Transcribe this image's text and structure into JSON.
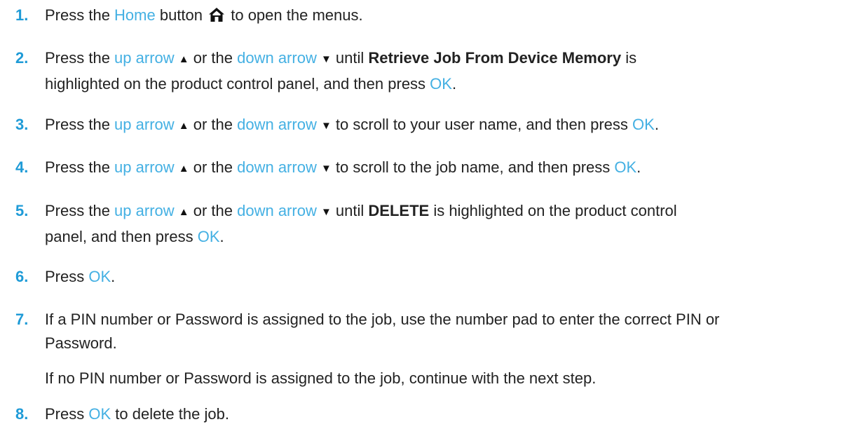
{
  "steps": [
    {
      "num": "1.",
      "t1": "Press the ",
      "k1": "Home",
      "t2": " button ",
      "t3": " to open the menus.",
      "icon": "home-icon"
    },
    {
      "num": "2.",
      "t1": "Press the ",
      "k1": "up arrow",
      "up_glyph": "▲",
      "t2": " or the ",
      "k2": "down arrow",
      "down_glyph": "▼",
      "t3": " until ",
      "bold": "Retrieve Job From Device Memory",
      "t4": " is",
      "line2": "highlighted on the product control panel, and then press ",
      "k3": "OK",
      "t5": "."
    },
    {
      "num": "3.",
      "t1": "Press the ",
      "k1": "up arrow",
      "up_glyph": "▲",
      "t2": " or the ",
      "k2": "down arrow",
      "down_glyph": "▼",
      "t3": " to scroll to your user name, and then press ",
      "k3": "OK",
      "t4": "."
    },
    {
      "num": "4.",
      "t1": "Press the ",
      "k1": "up arrow",
      "up_glyph": "▲",
      "t2": " or the ",
      "k2": "down arrow",
      "down_glyph": "▼",
      "t3": " to scroll to the job name, and then press ",
      "k3": "OK",
      "t4": "."
    },
    {
      "num": "5.",
      "t1": "Press the ",
      "k1": "up arrow",
      "up_glyph": "▲",
      "t2": " or the ",
      "k2": "down arrow",
      "down_glyph": "▼",
      "t3": " until ",
      "bold": "DELETE",
      "t4": " is highlighted on the product control",
      "line2": "panel, and then press ",
      "k3": "OK",
      "t5": "."
    },
    {
      "num": "6.",
      "t1": "Press ",
      "k1": "OK",
      "t2": "."
    },
    {
      "num": "7.",
      "line1": "If a PIN number or Password is assigned to the job, use the number pad to enter the correct PIN or",
      "line2": "Password.",
      "para2": "If no PIN number or Password is assigned to the job, continue with the next step."
    },
    {
      "num": "8.",
      "t1": "Press ",
      "k1": "OK",
      "t2": " to delete the job."
    }
  ],
  "colors": {
    "step_number": "#1f9bd7",
    "keyword": "#44b0e3",
    "body_text": "#222222"
  }
}
